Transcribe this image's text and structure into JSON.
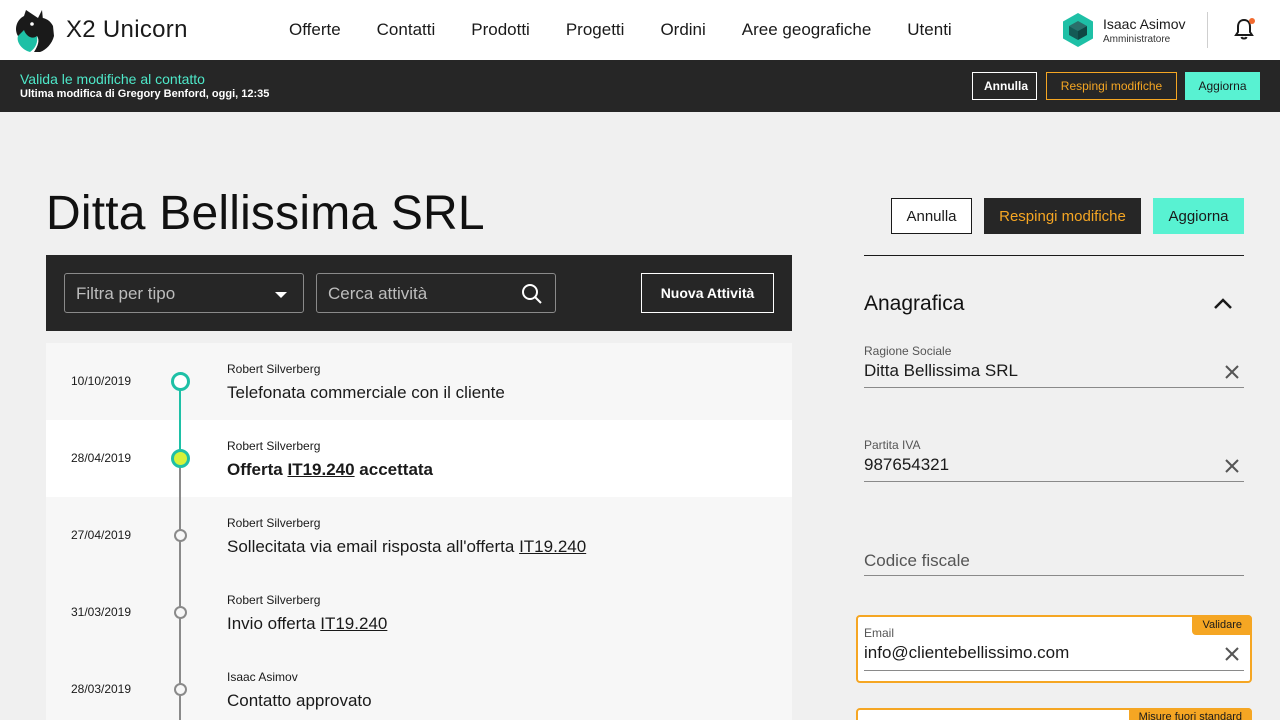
{
  "brand": {
    "name": "X2 Unicorn"
  },
  "nav": [
    "Offerte",
    "Contatti",
    "Prodotti",
    "Progetti",
    "Ordini",
    "Aree geografiche",
    "Utenti"
  ],
  "user": {
    "name": "Isaac Asimov",
    "role": "Amministratore"
  },
  "validation_bar": {
    "title": "Valida le modifiche al contatto",
    "subtitle": "Ultima modifica di Gregory Benford, oggi, 12:35",
    "cancel": "Annulla",
    "reject": "Respingi modifiche",
    "update": "Aggiorna"
  },
  "page": {
    "title": "Ditta Bellissima SRL",
    "cancel": "Annulla",
    "reject": "Respingi modifiche",
    "update": "Aggiorna"
  },
  "activities": {
    "filter_placeholder": "Filtra per tipo",
    "search_placeholder": "Cerca attività",
    "new_button": "Nuova Attività",
    "items": [
      {
        "date": "10/10/2019",
        "author": "Robert Silverberg",
        "pre": "Telefonata commerciale con il cliente",
        "ref": "",
        "post": ""
      },
      {
        "date": "28/04/2019",
        "author": "Robert Silverberg",
        "pre": "Offerta ",
        "ref": "IT19.240",
        "post": " accettata"
      },
      {
        "date": "27/04/2019",
        "author": "Robert Silverberg",
        "pre": "Sollecitata via email risposta all'offerta ",
        "ref": "IT19.240",
        "post": ""
      },
      {
        "date": "31/03/2019",
        "author": "Robert Silverberg",
        "pre": "Invio offerta ",
        "ref": "IT19.240",
        "post": ""
      },
      {
        "date": "28/03/2019",
        "author": "Isaac Asimov",
        "pre": "Contatto approvato",
        "ref": "",
        "post": ""
      }
    ]
  },
  "anagrafica": {
    "title": "Anagrafica",
    "ragione_sociale": {
      "label": "Ragione Sociale",
      "value": "Ditta Bellissima SRL"
    },
    "partita_iva": {
      "label": "Partita IVA",
      "value": "987654321"
    },
    "codice_fiscale": {
      "placeholder": "Codice fiscale"
    },
    "email": {
      "label": "Email",
      "value": "info@clientebellissimo.com",
      "tag": "Validare"
    },
    "next_tag": "Misure fuori standard"
  },
  "colors": {
    "accent_teal": "#58f2d2",
    "warning_orange": "#f5a623",
    "dark": "#262626"
  }
}
